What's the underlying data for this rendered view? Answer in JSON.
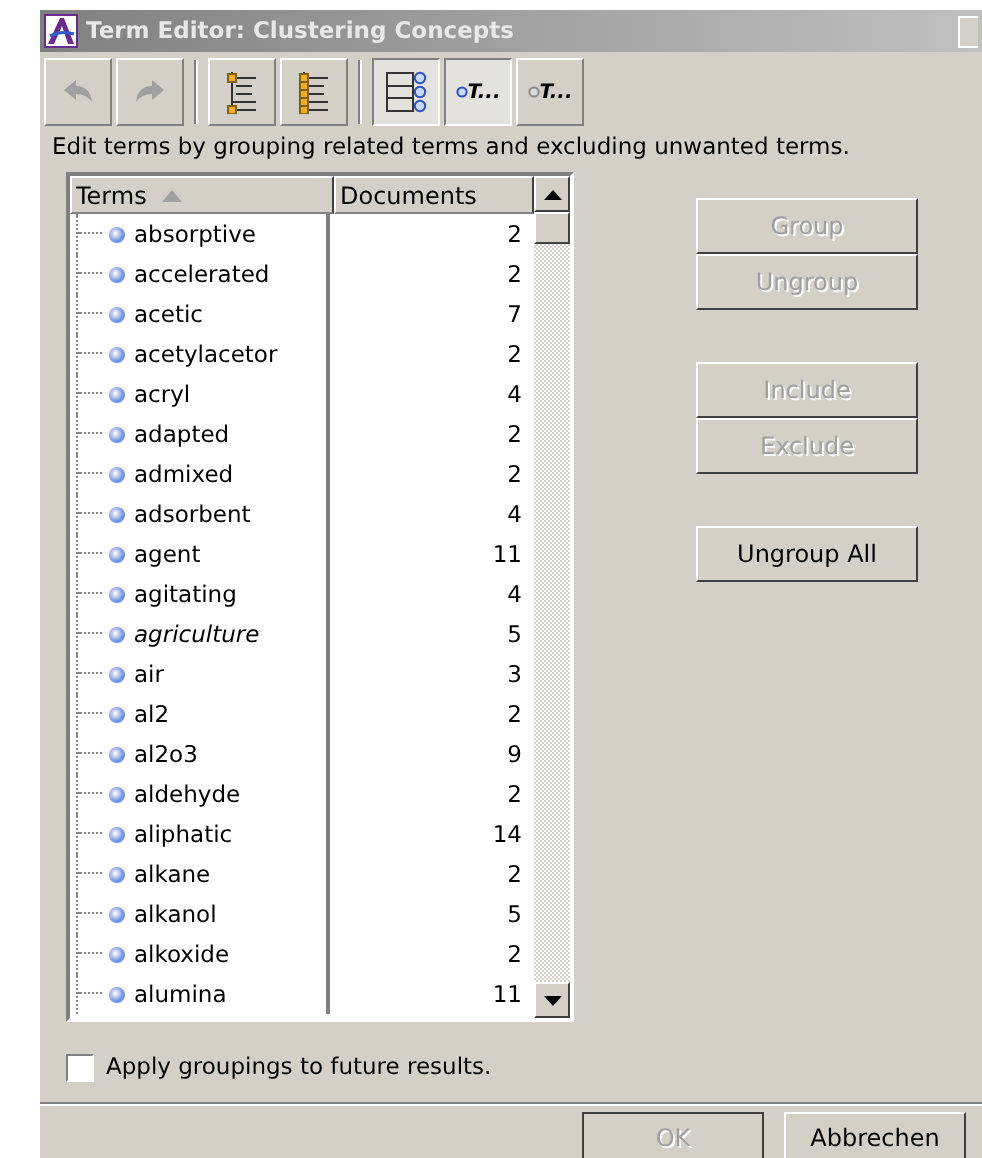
{
  "window": {
    "title": "Term Editor: Clustering Concepts"
  },
  "toolbar": [
    {
      "kind": "undo",
      "disabled": true,
      "selected": false
    },
    {
      "kind": "redo",
      "disabled": true,
      "selected": false
    },
    {
      "kind": "sep"
    },
    {
      "kind": "list",
      "disabled": false,
      "selected": false
    },
    {
      "kind": "list2",
      "disabled": false,
      "selected": false
    },
    {
      "kind": "sep"
    },
    {
      "kind": "tree",
      "disabled": false,
      "selected": true
    },
    {
      "kind": "term",
      "label": "T...",
      "disabled": false,
      "selected": true
    },
    {
      "kind": "term",
      "label": "T...",
      "disabled": false,
      "selected": false
    }
  ],
  "instruction": "Edit terms by grouping related terms and excluding unwanted terms.",
  "table": {
    "columns": [
      "Terms",
      "Documents"
    ],
    "rows": [
      {
        "term": "absorptive",
        "documents": "2",
        "italic": false
      },
      {
        "term": "accelerated",
        "documents": "2",
        "italic": false
      },
      {
        "term": "acetic",
        "documents": "7",
        "italic": false
      },
      {
        "term": "acetylacetor",
        "documents": "2",
        "italic": false
      },
      {
        "term": "acryl",
        "documents": "4",
        "italic": false
      },
      {
        "term": "adapted",
        "documents": "2",
        "italic": false
      },
      {
        "term": "admixed",
        "documents": "2",
        "italic": false
      },
      {
        "term": "adsorbent",
        "documents": "4",
        "italic": false
      },
      {
        "term": "agent",
        "documents": "11",
        "italic": false
      },
      {
        "term": "agitating",
        "documents": "4",
        "italic": false
      },
      {
        "term": "agriculture",
        "documents": "5",
        "italic": true
      },
      {
        "term": "air",
        "documents": "3",
        "italic": false
      },
      {
        "term": "al2",
        "documents": "2",
        "italic": false
      },
      {
        "term": "al2o3",
        "documents": "9",
        "italic": false
      },
      {
        "term": "aldehyde",
        "documents": "2",
        "italic": false
      },
      {
        "term": "aliphatic",
        "documents": "14",
        "italic": false
      },
      {
        "term": "alkane",
        "documents": "2",
        "italic": false
      },
      {
        "term": "alkanol",
        "documents": "5",
        "italic": false
      },
      {
        "term": "alkoxide",
        "documents": "2",
        "italic": false
      },
      {
        "term": "alumina",
        "documents": "11",
        "italic": false
      }
    ]
  },
  "side_button_groups": [
    [
      {
        "label": "Group",
        "disabled": true
      },
      {
        "label": "Ungroup",
        "disabled": true
      }
    ],
    [
      {
        "label": "Include",
        "disabled": true
      },
      {
        "label": "Exclude",
        "disabled": true
      }
    ],
    [
      {
        "label": "Ungroup All",
        "disabled": false
      }
    ]
  ],
  "apply_groupings": {
    "label": "Apply groupings to future results.",
    "checked": false
  },
  "footer_buttons": [
    {
      "label": "OK",
      "disabled": true
    },
    {
      "label": "Abbrechen",
      "disabled": false
    }
  ]
}
